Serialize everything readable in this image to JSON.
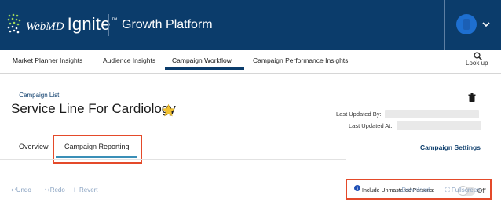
{
  "banner": {
    "brand_webmd": "WebMD",
    "brand_ignite": "Ignite",
    "brand_tm": "™",
    "platform": "Growth Platform",
    "logo_icon": "dotted-flame-logo-icon",
    "avatar_icon": "user-avatar-icon",
    "menu_icon": "chevron-down-icon"
  },
  "nav": {
    "items": [
      {
        "label": "Market Planner Insights"
      },
      {
        "label": "Audience Insights"
      },
      {
        "label": "Campaign Workflow"
      },
      {
        "label": "Campaign Performance Insights"
      }
    ],
    "active_index": 2,
    "lookup_label": "Look up",
    "lookup_icon": "search-icon"
  },
  "header": {
    "back_label": "← Campaign List",
    "title": "Service Line For Cardiology",
    "favorite_icon": "star-icon",
    "delete_icon": "trash-icon",
    "last_updated_by_label": "Last Updated By:",
    "last_updated_at_label": "Last Updated At:"
  },
  "tabs": {
    "items": [
      {
        "label": "Overview"
      },
      {
        "label": "Campaign Reporting"
      }
    ],
    "active_index": 1,
    "settings_label": "Campaign Settings"
  },
  "unmastered": {
    "label": "Include Unmastered Persons:",
    "state_text": "Off",
    "enabled": false,
    "info_icon": "info-icon"
  },
  "toolbar": {
    "undo": "↩Undo",
    "redo": "↪Redo",
    "revert": "⊢Revert",
    "download": "⤓Download",
    "fullscreen": "⛶ Fullscreen"
  },
  "colors": {
    "banner": "#0b3c6b",
    "accent_underline": "#3a8fb7",
    "highlight": "#e44a2a",
    "star": "#f2c230",
    "link": "#0b3c6b"
  }
}
